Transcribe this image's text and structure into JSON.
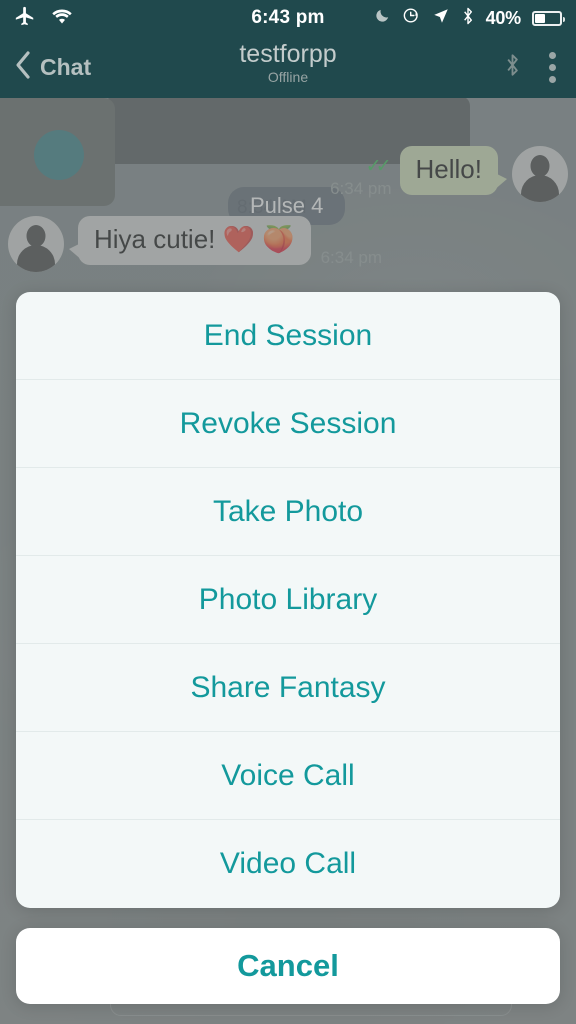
{
  "status_bar": {
    "time": "6:43 pm",
    "battery_percent": "40%",
    "battery_level": 40,
    "icons": [
      "airplane-mode-icon",
      "wifi-icon",
      "do-not-disturb-moon-icon",
      "rotation-lock-icon",
      "location-arrow-icon",
      "bluetooth-icon",
      "battery-icon"
    ]
  },
  "nav_bar": {
    "back_label": "Chat",
    "title": "testforpp",
    "subtitle": "Offline",
    "right_icons": [
      "bluetooth-icon",
      "overflow-menu-icon"
    ]
  },
  "chat": {
    "toast": "Pulse 4",
    "occluded_text": "8:34 AM",
    "messages": [
      {
        "id": "msg-out-1",
        "direction": "outgoing",
        "text": "Hello!",
        "time": "6:34 pm",
        "status": "read",
        "ticks": "✓✓"
      },
      {
        "id": "msg-in-1",
        "direction": "incoming",
        "text": "Hiya cutie! ❤️ 🍑",
        "time": "6:34 pm"
      }
    ]
  },
  "action_sheet": {
    "items": [
      {
        "label": "End Session"
      },
      {
        "label": "Revoke Session"
      },
      {
        "label": "Take Photo"
      },
      {
        "label": "Photo Library"
      },
      {
        "label": "Share Fantasy"
      },
      {
        "label": "Voice Call"
      },
      {
        "label": "Video Call"
      }
    ],
    "cancel_label": "Cancel"
  },
  "colors": {
    "nav_bar": "#20494d",
    "accent_teal": "#13999c",
    "sheet_background": "#f3f8f8",
    "cancel_background": "#ffffff",
    "outgoing_bubble": "#cfddb4",
    "incoming_bubble": "#d6d6d4",
    "tick_green": "#2fbf4f",
    "dim_overlay": "#7e8585"
  }
}
